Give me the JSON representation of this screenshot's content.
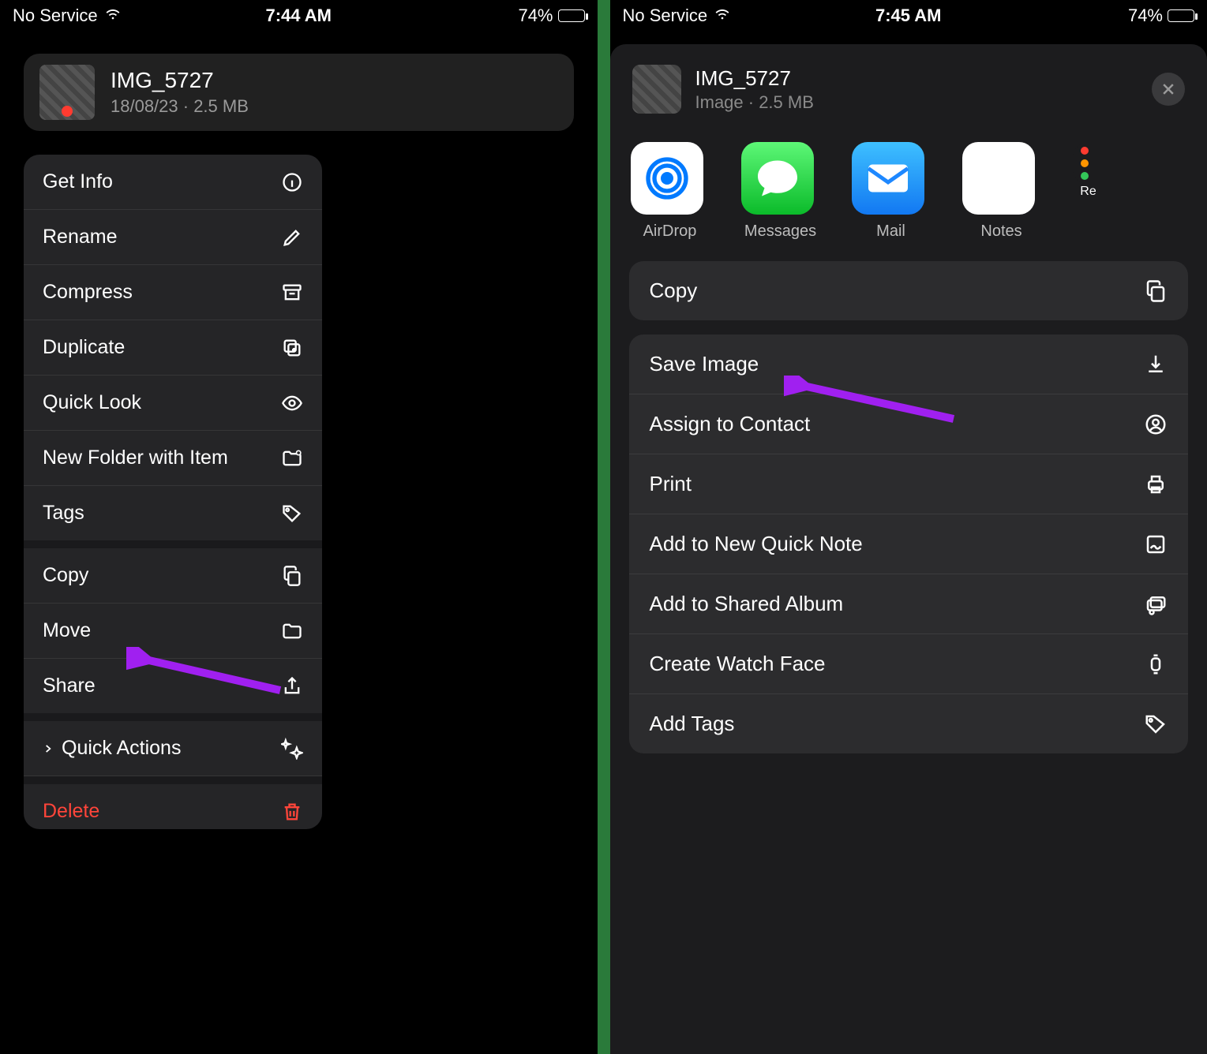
{
  "left": {
    "status": {
      "service": "No Service",
      "time": "7:44 AM",
      "battery": "74%"
    },
    "file": {
      "name": "IMG_5727",
      "meta": "18/08/23 · 2.5 MB"
    },
    "menu": {
      "g1": [
        {
          "label": "Get Info",
          "icon": "info"
        },
        {
          "label": "Rename",
          "icon": "pencil"
        },
        {
          "label": "Compress",
          "icon": "archivebox"
        },
        {
          "label": "Duplicate",
          "icon": "duplicate"
        },
        {
          "label": "Quick Look",
          "icon": "eye"
        },
        {
          "label": "New Folder with Item",
          "icon": "folderplus"
        },
        {
          "label": "Tags",
          "icon": "tag"
        }
      ],
      "g2": [
        {
          "label": "Copy",
          "icon": "copy"
        },
        {
          "label": "Move",
          "icon": "folder"
        },
        {
          "label": "Share",
          "icon": "share"
        }
      ],
      "quickActions": "Quick Actions",
      "delete": "Delete"
    }
  },
  "right": {
    "status": {
      "service": "No Service",
      "time": "7:45 AM",
      "battery": "74%"
    },
    "file": {
      "name": "IMG_5727",
      "meta": "Image · 2.5 MB"
    },
    "apps": [
      {
        "label": "AirDrop",
        "kind": "airdrop"
      },
      {
        "label": "Messages",
        "kind": "messages"
      },
      {
        "label": "Mail",
        "kind": "mail"
      },
      {
        "label": "Notes",
        "kind": "notes"
      }
    ],
    "partialAppLabel": "Re",
    "copyLabel": "Copy",
    "actions": [
      {
        "label": "Save Image",
        "icon": "download"
      },
      {
        "label": "Assign to Contact",
        "icon": "person"
      },
      {
        "label": "Print",
        "icon": "print"
      },
      {
        "label": "Add to New Quick Note",
        "icon": "note"
      },
      {
        "label": "Add to Shared Album",
        "icon": "album"
      },
      {
        "label": "Create Watch Face",
        "icon": "watch"
      },
      {
        "label": "Add Tags",
        "icon": "tag"
      }
    ]
  }
}
